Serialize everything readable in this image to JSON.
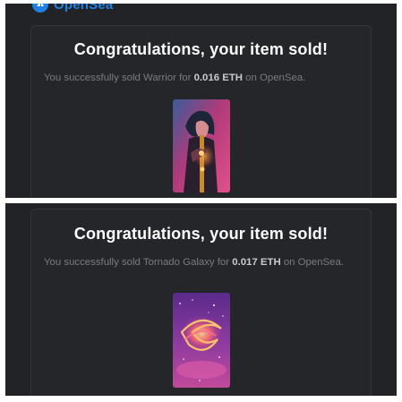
{
  "header": {
    "logo_text": "OpenSea",
    "logo_icon": "opensea-logo-icon"
  },
  "emails": [
    {
      "title": "Congratulations, your item sold!",
      "message_prefix": "You successfully sold ",
      "item_name": "Warrior",
      "message_middle": " for ",
      "price": "0.016 ETH",
      "message_suffix": " on OpenSea.",
      "image_icon": "warrior-artwork"
    },
    {
      "title": "Congratulations, your item sold!",
      "message_prefix": "You successfully sold ",
      "item_name": "Tornado Galaxy",
      "message_middle": " for ",
      "price": "0.017 ETH",
      "message_suffix": " on OpenSea.",
      "image_icon": "tornado-galaxy-artwork"
    }
  ]
}
